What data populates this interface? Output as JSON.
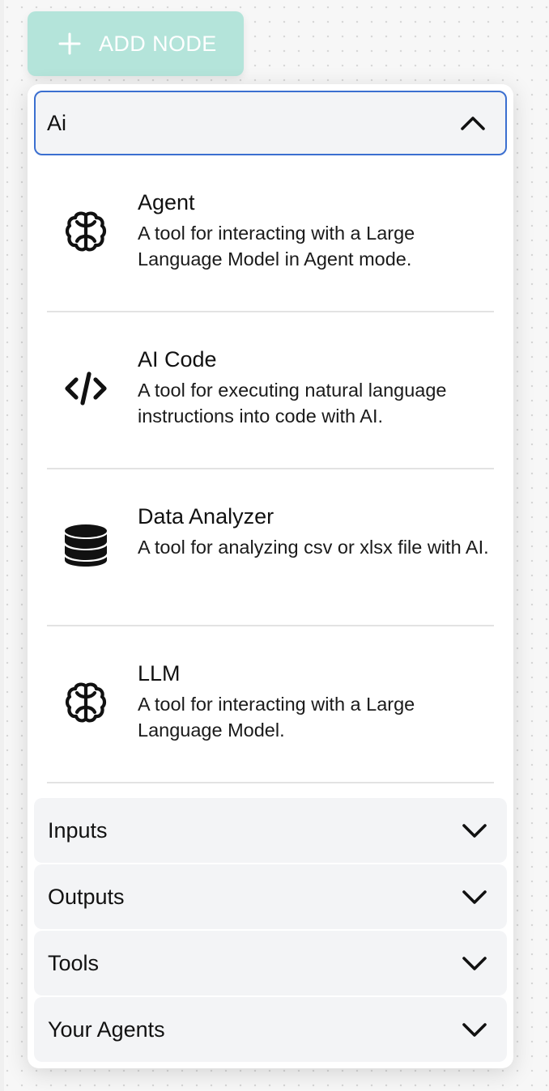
{
  "toolbar": {
    "add_node_label": "ADD NODE"
  },
  "panel": {
    "open_category": {
      "label": "Ai",
      "items": [
        {
          "title": "Agent",
          "description": "A tool for interacting with a Large Language Model in Agent mode.",
          "icon": "brain-icon"
        },
        {
          "title": "AI Code",
          "description": "A tool for executing natural language instructions into code with AI.",
          "icon": "code-icon"
        },
        {
          "title": "Data Analyzer",
          "description": "A tool for analyzing csv or xlsx file with AI.",
          "icon": "database-icon"
        },
        {
          "title": "LLM",
          "description": "A tool for interacting with a Large Language Model.",
          "icon": "brain-icon"
        }
      ]
    },
    "collapsed_categories": [
      {
        "label": "Inputs"
      },
      {
        "label": "Outputs"
      },
      {
        "label": "Tools"
      },
      {
        "label": "Your Agents"
      }
    ]
  },
  "colors": {
    "add_button_bg": "#b4e4da",
    "focus_border": "#3b6fd0",
    "category_bg": "#f3f4f6"
  }
}
